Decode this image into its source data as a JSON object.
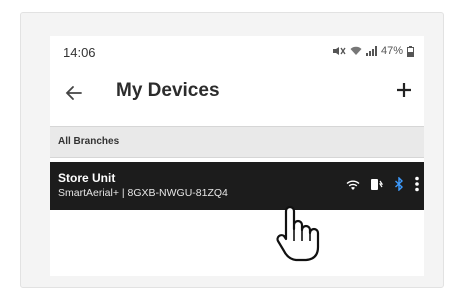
{
  "status_bar": {
    "time": "14:06",
    "battery_text": "47%",
    "icons": [
      "mute-icon",
      "wifi-icon",
      "signal-icon",
      "battery-icon"
    ]
  },
  "app_bar": {
    "title": "My Devices",
    "back_icon": "back-arrow-icon",
    "add_icon": "plus-icon"
  },
  "branch_filter": {
    "label": "All Branches"
  },
  "devices": [
    {
      "name": "Store Unit",
      "subtitle": "SmartAerial+ | 8GXB-NWGU-81ZQ4",
      "icons": [
        "wifi-icon",
        "power-plug-icon",
        "bluetooth-icon",
        "more-vert-icon"
      ]
    }
  ],
  "colors": {
    "row_background": "#1c1c1c",
    "branch_background": "#e9e9e9",
    "bluetooth": "#3d9bff",
    "title": "#2c2c2c"
  }
}
